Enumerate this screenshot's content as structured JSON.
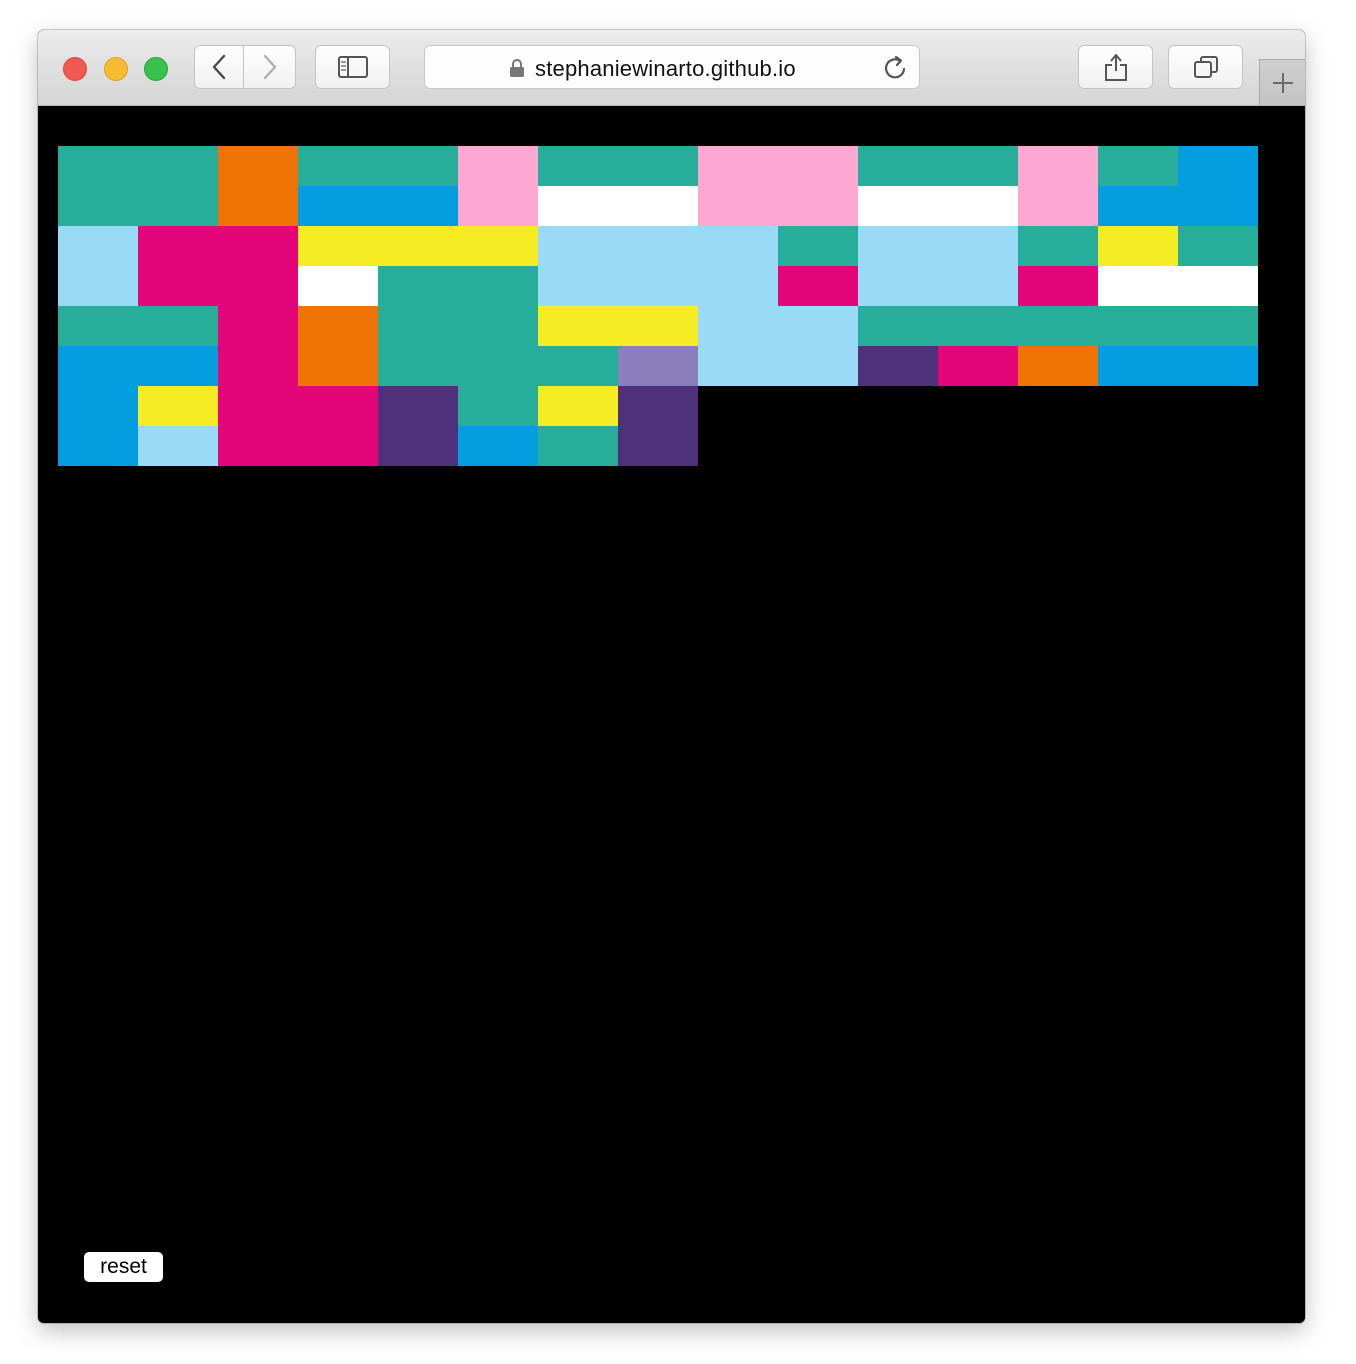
{
  "browser": {
    "url": "stephaniewinarto.github.io",
    "icons": [
      "back-icon",
      "forward-icon",
      "sidebar-icon",
      "lock-icon",
      "reload-icon",
      "share-icon",
      "tabs-icon",
      "new-tab-icon"
    ]
  },
  "palette": {
    "teal": "#26AE9B",
    "orange": "#F07305",
    "pink": "#FDA8D2",
    "blue": "#039DE0",
    "white": "#FFFFFF",
    "light_blue": "#9BDAF6",
    "magenta": "#E4057A",
    "yellow": "#F6EC23",
    "purple": "#4E307B",
    "lavender": "#8A7FBC",
    "background": "#000000"
  },
  "grid": {
    "cell_rows": [
      [
        "teal",
        "teal",
        "orange",
        "teal",
        "teal",
        "pink",
        "teal",
        "teal",
        "pink",
        "pink",
        "teal",
        "teal",
        "pink",
        "teal",
        "blue"
      ],
      [
        "teal",
        "teal",
        "orange",
        "blue",
        "blue",
        "pink",
        "white",
        "white",
        "pink",
        "pink",
        "white",
        "white",
        "pink",
        "blue",
        "blue"
      ],
      [
        "light_blue",
        "magenta",
        "magenta",
        "yellow",
        "yellow",
        "yellow",
        "light_blue",
        "light_blue",
        "light_blue",
        "teal",
        "light_blue",
        "light_blue",
        "teal",
        "yellow",
        "teal"
      ],
      [
        "light_blue",
        "magenta",
        "magenta",
        "white",
        "teal",
        "teal",
        "light_blue",
        "light_blue",
        "light_blue",
        "magenta",
        "light_blue",
        "light_blue",
        "magenta",
        "white",
        "white"
      ],
      [
        "teal",
        "teal",
        "magenta",
        "orange",
        "teal",
        "teal",
        "yellow",
        "yellow",
        "light_blue",
        "light_blue",
        "teal",
        "teal",
        "teal",
        "teal",
        "teal"
      ],
      [
        "blue",
        "blue",
        "magenta",
        "orange",
        "teal",
        "teal",
        "teal",
        "lavender",
        "light_blue",
        "light_blue",
        "purple",
        "magenta",
        "orange",
        "blue",
        "blue"
      ],
      [
        "blue",
        "yellow",
        "magenta",
        "magenta",
        "purple",
        "teal",
        "yellow",
        "purple"
      ],
      [
        "blue",
        "light_blue",
        "magenta",
        "magenta",
        "purple",
        "blue",
        "teal",
        "purple"
      ]
    ]
  },
  "controls": {
    "reset_label": "reset"
  }
}
